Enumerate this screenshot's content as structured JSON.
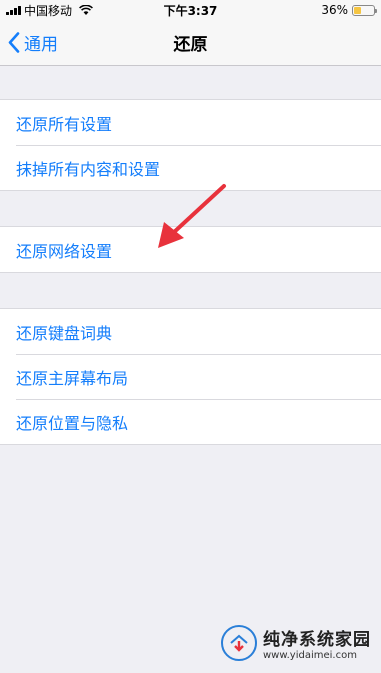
{
  "status_bar": {
    "carrier": "中国移动",
    "time": "下午3:37",
    "battery_percent": "36%",
    "battery_level": 0.36,
    "battery_color": "#f5c542"
  },
  "nav": {
    "back_label": "通用",
    "title": "还原"
  },
  "groups": [
    {
      "items": [
        "还原所有设置",
        "抹掉所有内容和设置"
      ]
    },
    {
      "items": [
        "还原网络设置"
      ]
    },
    {
      "items": [
        "还原键盘词典",
        "还原主屏幕布局",
        "还原位置与隐私"
      ]
    }
  ],
  "annotation": {
    "color": "#e8323c",
    "points_to": "还原网络设置"
  },
  "watermark": {
    "name": "纯净系统家园",
    "url": "www.yidaimei.com"
  },
  "colors": {
    "accent": "#147efb",
    "background": "#efeff4"
  }
}
